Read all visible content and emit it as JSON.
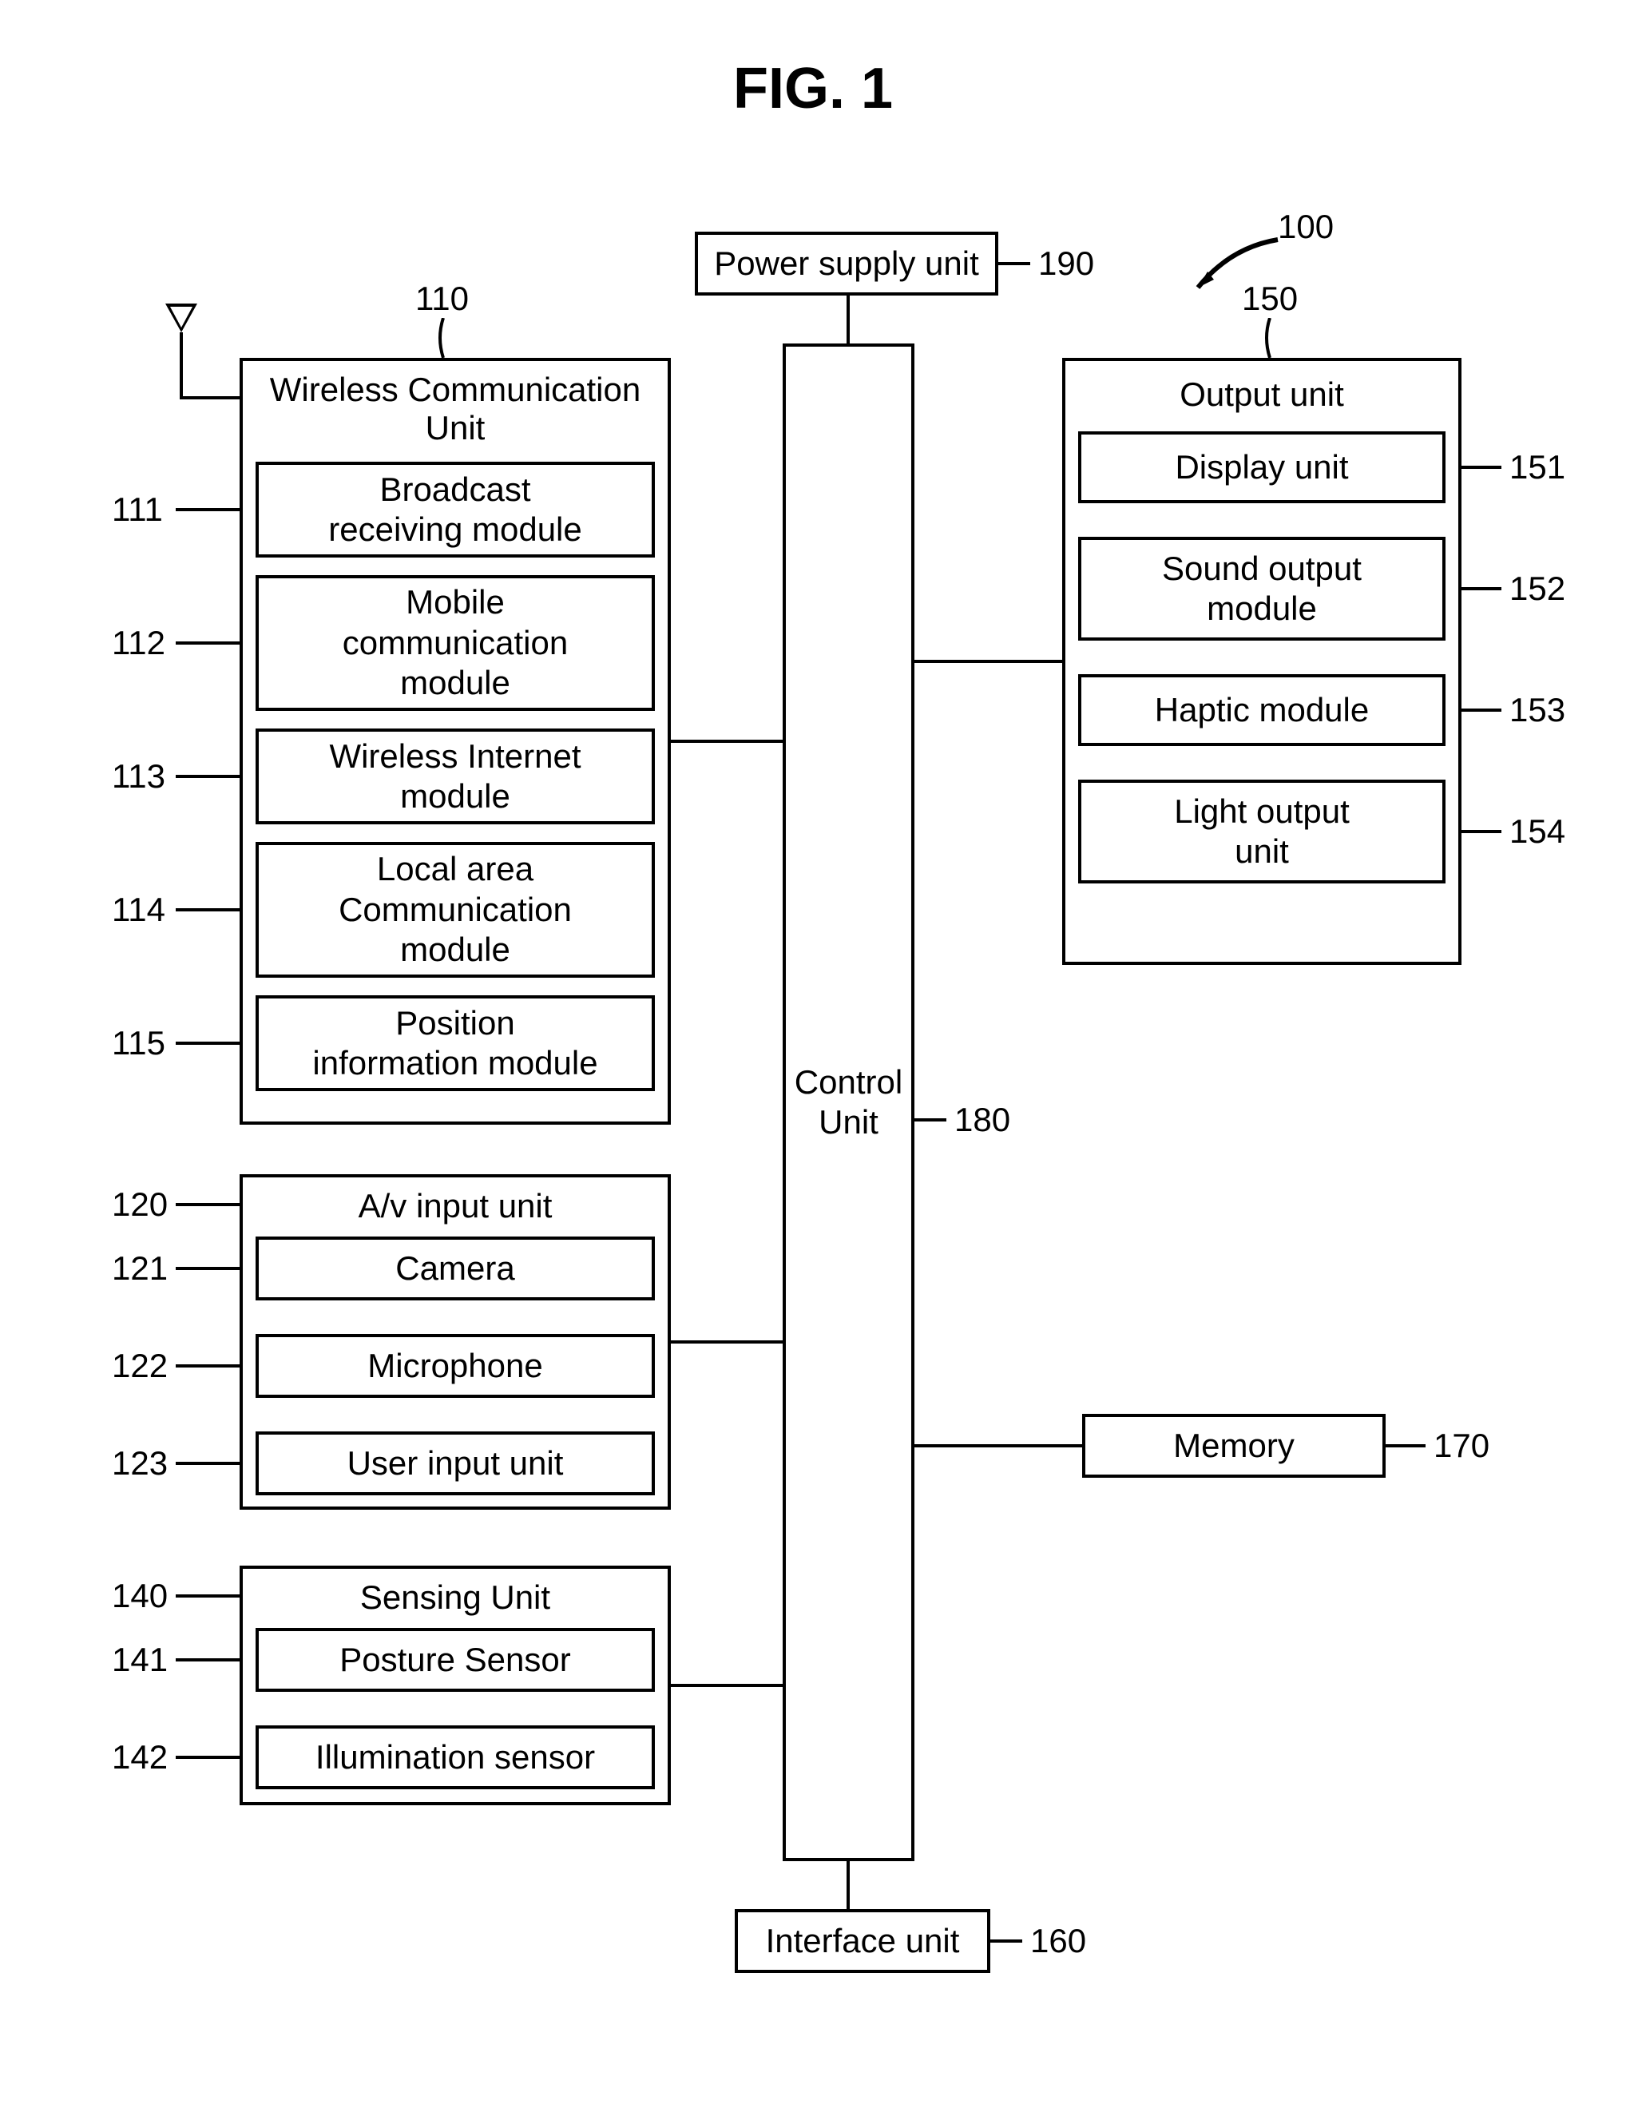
{
  "figure_title": "FIG. 1",
  "system_ref": "100",
  "power": {
    "ref": "190",
    "label": "Power supply unit"
  },
  "control": {
    "ref": "180",
    "label": "Control\nUnit"
  },
  "interface": {
    "ref": "160",
    "label": "Interface unit"
  },
  "memory": {
    "ref": "170",
    "label": "Memory"
  },
  "wireless": {
    "ref": "110",
    "title": "Wireless Communication\nUnit",
    "items": [
      {
        "ref": "111",
        "label": "Broadcast\nreceiving module"
      },
      {
        "ref": "112",
        "label": "Mobile\ncommunication\nmodule"
      },
      {
        "ref": "113",
        "label": "Wireless Internet\nmodule"
      },
      {
        "ref": "114",
        "label": "Local area\nCommunication\nmodule"
      },
      {
        "ref": "115",
        "label": "Position\ninformation module"
      }
    ]
  },
  "av": {
    "ref": "120",
    "title": "A/v input unit",
    "items": [
      {
        "ref": "121",
        "label": "Camera"
      },
      {
        "ref": "122",
        "label": "Microphone"
      },
      {
        "ref": "123",
        "label": "User input unit"
      }
    ]
  },
  "sensing": {
    "ref": "140",
    "title": "Sensing Unit",
    "items": [
      {
        "ref": "141",
        "label": "Posture Sensor"
      },
      {
        "ref": "142",
        "label": "Illumination sensor"
      }
    ]
  },
  "output": {
    "ref": "150",
    "title": "Output unit",
    "items": [
      {
        "ref": "151",
        "label": "Display unit"
      },
      {
        "ref": "152",
        "label": "Sound output\nmodule"
      },
      {
        "ref": "153",
        "label": "Haptic module"
      },
      {
        "ref": "154",
        "label": "Light output\nunit"
      }
    ]
  }
}
